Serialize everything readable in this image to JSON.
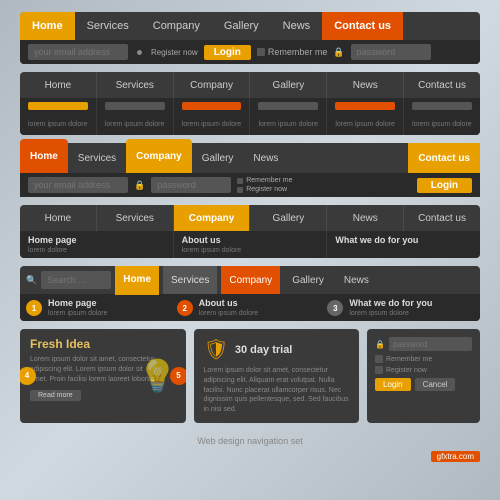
{
  "nav1": {
    "items": [
      "Home",
      "Services",
      "Company",
      "Gallery",
      "News",
      "Contact us"
    ],
    "email_placeholder": "your email address",
    "login_btn": "Login",
    "remember_me": "Remember me",
    "password_placeholder": "password"
  },
  "nav2": {
    "items": [
      "Home",
      "Services",
      "Company",
      "Gallery",
      "News",
      "Contact us"
    ],
    "subs": [
      {
        "label": "",
        "color": "yellow",
        "text": "lorem ipsum dolore"
      },
      {
        "label": "",
        "color": "gray",
        "text": "lorem ipsum dolore"
      },
      {
        "label": "",
        "color": "orange",
        "text": "lorem ipsum dolore"
      },
      {
        "label": "",
        "color": "gray",
        "text": "lorem ipsum dolore"
      },
      {
        "label": "",
        "color": "orange",
        "text": "lorem ipsum dolore"
      },
      {
        "label": "",
        "color": "gray",
        "text": "lorem ipsum dolore"
      }
    ]
  },
  "nav3": {
    "items": [
      "Home",
      "Services",
      "Company",
      "Gallery",
      "News",
      "Contact us"
    ],
    "email_placeholder": "your email address",
    "password_placeholder": "password",
    "login_btn": "Login",
    "remember_me": "Remember me",
    "register_now": "Register now"
  },
  "nav4": {
    "items": [
      "Home",
      "Services",
      "Company",
      "Gallery",
      "News",
      "Contact us"
    ],
    "subs": [
      {
        "title": "Home page",
        "text": "lorem dolore"
      },
      {
        "title": "About us",
        "text": "lorem ipsum dolore"
      },
      {
        "title": "What we do for you",
        "text": ""
      }
    ]
  },
  "nav5": {
    "search_placeholder": "Search ...",
    "items": [
      "Home",
      "Services",
      "Company",
      "Gallery",
      "News"
    ],
    "subs": [
      {
        "num": "1",
        "title": "Home page",
        "text": "lorem ipsum dolore"
      },
      {
        "num": "2",
        "title": "About us",
        "text": "lorem ipsum dolore"
      },
      {
        "num": "3",
        "title": "What we do for you",
        "text": "lorem ipsum dolore"
      }
    ]
  },
  "card_fresh": {
    "num_left": "4",
    "num_right": "5",
    "title": "Fresh Idea",
    "text": "Lorem ipsum dolor sit amet, consectetur adipiscing elit. Lorem ipsum dolor sit amet. Proin facilisi lorem laoreet lobortis.",
    "btn": "Read more"
  },
  "card_trial": {
    "title": "30 day trial",
    "text": "Lorem ipsum dolor sit amet, consectetur adipiscing elit. Aliquam erat volutpat. Nulla facilisi. Nunc placerat ullamcorper risus. Nec dignissim quis pellentesque, sed. Sed faucibus in nisi sed."
  },
  "card_form": {
    "password_placeholder": "password",
    "remember_me": "Remember me",
    "register_now": "Register now",
    "login_btn": "Login",
    "cancel_btn": "Cancel"
  },
  "watermark": {
    "text": "Web design navigation set",
    "badge": "gfxtra.com"
  }
}
